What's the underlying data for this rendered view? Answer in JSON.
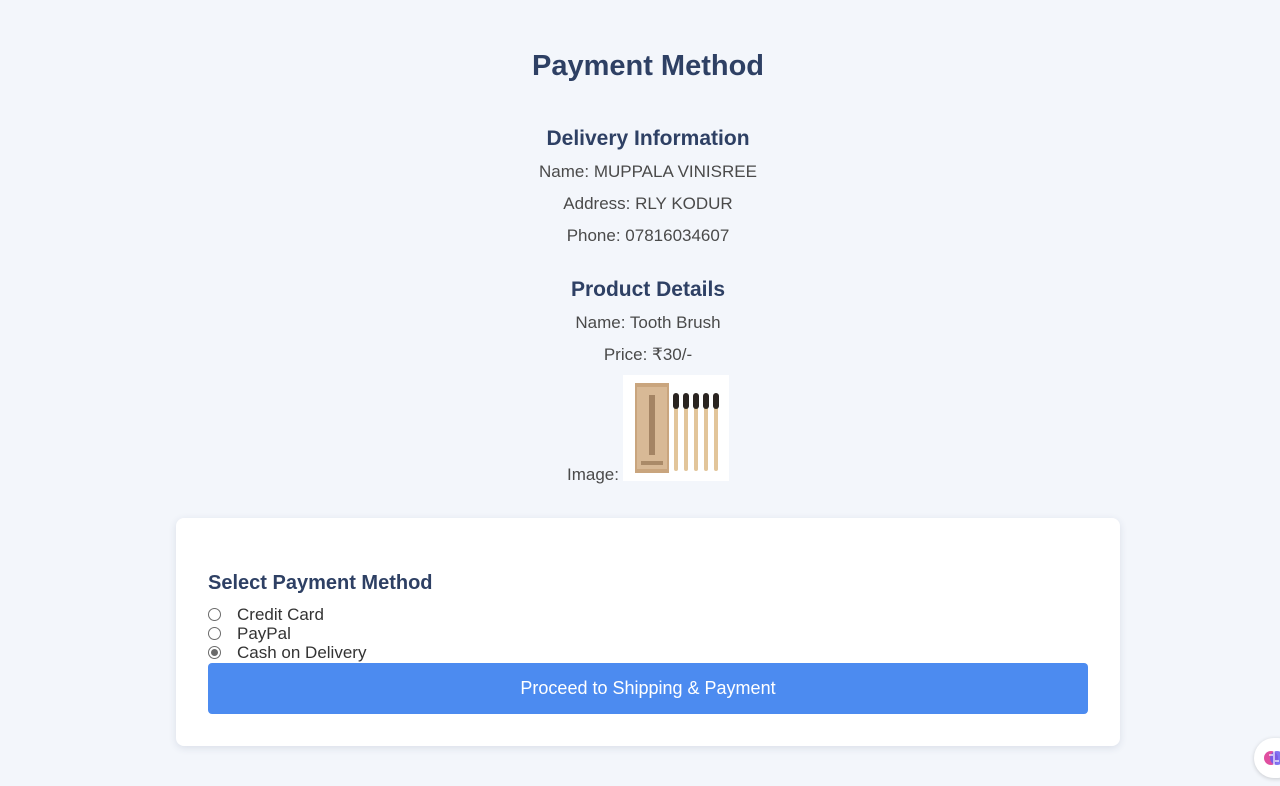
{
  "page": {
    "title": "Payment Method"
  },
  "delivery": {
    "heading": "Delivery Information",
    "name": "Name: MUPPALA VINISREE",
    "address": "Address: RLY KODUR",
    "phone": "Phone: 07816034607"
  },
  "product": {
    "heading": "Product Details",
    "name": "Name: Tooth Brush",
    "price": "Price: ₹30/-",
    "image_label": "Image:",
    "image_alt": "bamboo toothbrush pack image"
  },
  "payment": {
    "heading": "Select Payment Method",
    "options": [
      {
        "label": "Credit Card",
        "checked": false
      },
      {
        "label": "PayPal",
        "checked": false
      },
      {
        "label": "Cash on Delivery",
        "checked": true
      }
    ],
    "proceed_label": "Proceed to Shipping & Payment"
  },
  "colors": {
    "background": "#f3f6fb",
    "heading": "#2e4064",
    "button": "#4c8bf0"
  },
  "icons": {
    "corner_widget": "brain-icon"
  }
}
